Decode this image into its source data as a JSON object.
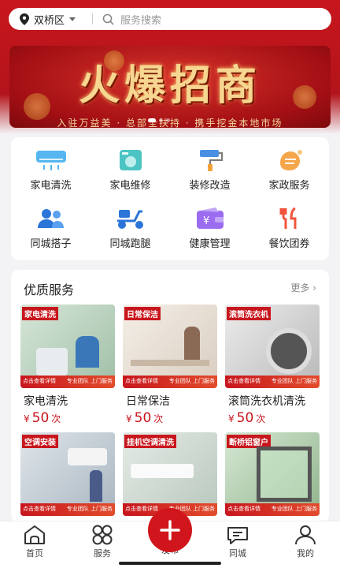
{
  "colors": {
    "brand": "#c8161d",
    "price": "#c8161d"
  },
  "search": {
    "location": "双桥区",
    "placeholder": "服务搜索"
  },
  "banner": {
    "headline": "火爆招商",
    "subline": "入驻万益美 · 总部全扶持 · 携手挖金本地市场"
  },
  "categories": [
    {
      "label": "家电清洗",
      "icon": "air-conditioner-icon"
    },
    {
      "label": "家电维修",
      "icon": "appliance-repair-icon"
    },
    {
      "label": "装修改造",
      "icon": "paint-roller-icon"
    },
    {
      "label": "家政服务",
      "icon": "cleaning-hand-icon"
    },
    {
      "label": "同城搭子",
      "icon": "people-icon"
    },
    {
      "label": "同城跑腿",
      "icon": "scooter-icon"
    },
    {
      "label": "健康管理",
      "icon": "wallet-icon"
    },
    {
      "label": "餐饮团券",
      "icon": "cutlery-icon"
    }
  ],
  "quality": {
    "title": "优质服务",
    "more": "更多"
  },
  "services": [
    {
      "tag": "家电清洗",
      "name": "家电清洗",
      "currency": "¥",
      "price": "50",
      "unit": "次"
    },
    {
      "tag": "日常保洁",
      "name": "日常保洁",
      "currency": "¥",
      "price": "50",
      "unit": "次"
    },
    {
      "tag": "滚筒洗衣机",
      "name": "滚筒洗衣机清洗",
      "currency": "¥",
      "price": "50",
      "unit": "次"
    },
    {
      "tag": "空调安装"
    },
    {
      "tag": "挂机空调清洗"
    },
    {
      "tag": "断桥铝窗户"
    }
  ],
  "thumb_footer": {
    "left": "点击查看详情",
    "right": "专业团队 上门服务"
  },
  "nav": {
    "home": "首页",
    "service": "服务",
    "publish": "发布",
    "city": "同城",
    "mine": "我的"
  }
}
